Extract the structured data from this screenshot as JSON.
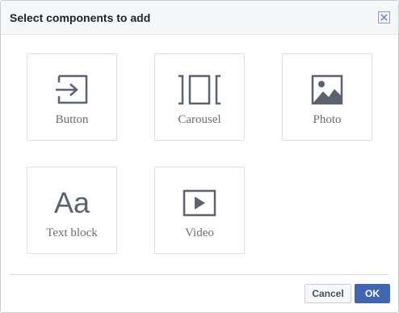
{
  "dialog": {
    "title": "Select components to add",
    "close_icon": "close-icon"
  },
  "components": [
    {
      "label": "Button",
      "icon": "button-arrow-icon"
    },
    {
      "label": "Carousel",
      "icon": "carousel-icon"
    },
    {
      "label": "Photo",
      "icon": "photo-icon"
    },
    {
      "label": "Text block",
      "icon": "text-block-icon",
      "glyph": "Aa"
    },
    {
      "label": "Video",
      "icon": "video-play-icon"
    }
  ],
  "footer": {
    "cancel_label": "Cancel",
    "ok_label": "OK"
  },
  "colors": {
    "primary": "#4267b2",
    "icon": "#5c6270",
    "label": "#6a6e78",
    "header_bg": "#f6f7f9",
    "border": "#dddfe2"
  }
}
